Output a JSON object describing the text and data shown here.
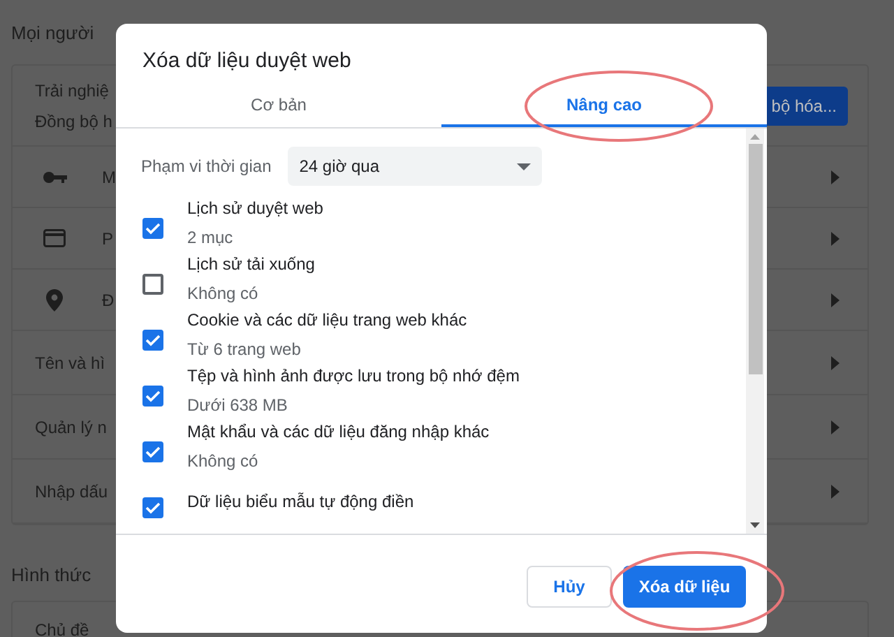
{
  "background": {
    "section_title": "Mọi người",
    "sync_card": {
      "lines": [
        "Trải nghiệ",
        "Đồng bộ h"
      ],
      "button": "bộ hóa..."
    },
    "rows": [
      {
        "kind": "key",
        "label": "M"
      },
      {
        "kind": "card",
        "label": "P"
      },
      {
        "kind": "pin",
        "label": "Đ"
      },
      {
        "kind": "text",
        "label": "Tên và hì"
      },
      {
        "kind": "text",
        "label": "Quản lý n"
      },
      {
        "kind": "text",
        "label": "Nhập dấu"
      }
    ],
    "section_2_title": "Hình thức",
    "section_2_rows": [
      "Chủ đề"
    ]
  },
  "dialog": {
    "title": "Xóa dữ liệu duyệt web",
    "tabs": [
      {
        "label": "Cơ bản",
        "selected": false
      },
      {
        "label": "Nâng cao",
        "selected": true
      }
    ],
    "time_range": {
      "label": "Phạm vi thời gian",
      "value": "24 giờ qua"
    },
    "items": [
      {
        "label": "Lịch sử duyệt web",
        "detail": "2 mục",
        "checked": true
      },
      {
        "label": "Lịch sử tải xuống",
        "detail": "Không có",
        "checked": false
      },
      {
        "label": "Cookie và các dữ liệu trang web khác",
        "detail": "Từ 6 trang web",
        "checked": true
      },
      {
        "label": "Tệp và hình ảnh được lưu trong bộ nhớ đệm",
        "detail": "Dưới 638 MB",
        "checked": true
      },
      {
        "label": "Mật khẩu và các dữ liệu đăng nhập khác",
        "detail": "Không có",
        "checked": true
      },
      {
        "label": "Dữ liệu biểu mẫu tự động điền",
        "checked": true
      }
    ],
    "buttons": [
      {
        "kind": "cancel",
        "label": "Hủy"
      },
      {
        "kind": "confirm",
        "label": "Xóa dữ liệu"
      }
    ]
  }
}
